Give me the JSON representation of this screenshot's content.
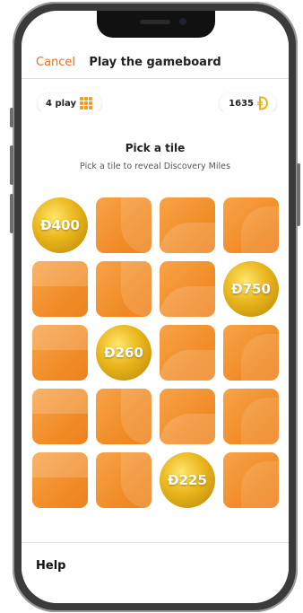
{
  "nav": {
    "cancel_label": "Cancel",
    "title": "Play the gameboard"
  },
  "stats": {
    "plays_label": "4 play",
    "miles_value": "1635"
  },
  "board": {
    "heading": "Pick a tile",
    "subheading": "Pick a tile to reveal Discovery Miles"
  },
  "tiles": [
    {
      "row": 1,
      "col": 1,
      "state": "revealed",
      "value": "Đ400"
    },
    {
      "row": 1,
      "col": 2,
      "state": "hidden"
    },
    {
      "row": 1,
      "col": 3,
      "state": "hidden"
    },
    {
      "row": 1,
      "col": 4,
      "state": "hidden"
    },
    {
      "row": 2,
      "col": 1,
      "state": "hidden"
    },
    {
      "row": 2,
      "col": 2,
      "state": "hidden"
    },
    {
      "row": 2,
      "col": 3,
      "state": "hidden"
    },
    {
      "row": 2,
      "col": 4,
      "state": "revealed",
      "value": "Đ750"
    },
    {
      "row": 3,
      "col": 1,
      "state": "hidden"
    },
    {
      "row": 3,
      "col": 2,
      "state": "revealed",
      "value": "Đ260"
    },
    {
      "row": 3,
      "col": 3,
      "state": "hidden"
    },
    {
      "row": 3,
      "col": 4,
      "state": "hidden"
    },
    {
      "row": 4,
      "col": 1,
      "state": "hidden"
    },
    {
      "row": 4,
      "col": 2,
      "state": "hidden"
    },
    {
      "row": 4,
      "col": 3,
      "state": "hidden"
    },
    {
      "row": 4,
      "col": 4,
      "state": "hidden"
    },
    {
      "row": 5,
      "col": 1,
      "state": "hidden"
    },
    {
      "row": 5,
      "col": 2,
      "state": "hidden"
    },
    {
      "row": 5,
      "col": 3,
      "state": "revealed",
      "value": "Đ225"
    },
    {
      "row": 5,
      "col": 4,
      "state": "hidden"
    }
  ],
  "footer": {
    "help_label": "Help"
  },
  "colors": {
    "accent": "#e8702a",
    "tile": "#f08a24",
    "coin": "#e9b51b"
  }
}
